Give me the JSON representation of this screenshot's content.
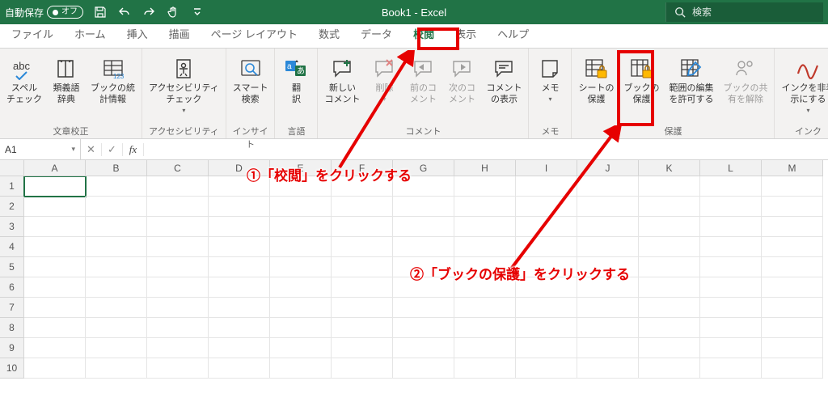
{
  "titlebar": {
    "autosave_label": "自動保存",
    "autosave_state": "オフ",
    "title_book": "Book1",
    "title_app": " - Excel",
    "search_placeholder": "検索"
  },
  "tabs": {
    "items": [
      {
        "label": "ファイル"
      },
      {
        "label": "ホーム"
      },
      {
        "label": "挿入"
      },
      {
        "label": "描画"
      },
      {
        "label": "ページ レイアウト"
      },
      {
        "label": "数式"
      },
      {
        "label": "データ"
      },
      {
        "label": "校閲",
        "active": true
      },
      {
        "label": "表示"
      },
      {
        "label": "ヘルプ"
      }
    ]
  },
  "ribbon": {
    "groups": {
      "proofing": {
        "label": "文章校正"
      },
      "accessibility": {
        "label": "アクセシビリティ"
      },
      "insight": {
        "label": "インサイト"
      },
      "language": {
        "label": "言語"
      },
      "comment": {
        "label": "コメント"
      },
      "memo": {
        "label": "メモ"
      },
      "protect": {
        "label": "保護"
      },
      "ink": {
        "label": "インク"
      }
    },
    "buttons": {
      "spell": "スペル\nチェック",
      "thesaurus": "類義語\n辞典",
      "stats": "ブックの統\n計情報",
      "access": "アクセシビリティ\nチェック",
      "smart": "スマート\n検索",
      "translate": "翻\n訳",
      "newcomment": "新しい\nコメント",
      "delete": "削除",
      "prevcomment": "前のコ\nメント",
      "nextcomment": "次のコ\nメント",
      "showcomments": "コメント\nの表示",
      "memo": "メモ",
      "protectsheet": "シートの\n保護",
      "protectbook": "ブックの\n保護",
      "alloweditrange": "範囲の編集\nを許可する",
      "unshare": "ブックの共\n有を解除",
      "hideink": "インクを非表\n示にする"
    }
  },
  "fbar": {
    "cellref": "A1"
  },
  "grid": {
    "columns": [
      "A",
      "B",
      "C",
      "D",
      "E",
      "F",
      "G",
      "H",
      "I",
      "J",
      "K",
      "L",
      "M"
    ],
    "rows": [
      "1",
      "2",
      "3",
      "4",
      "5",
      "6",
      "7",
      "8",
      "9",
      "10"
    ]
  },
  "annotations": {
    "a1": "①「校閲」をクリックする",
    "a2": "②「ブックの保護」をクリックする"
  }
}
